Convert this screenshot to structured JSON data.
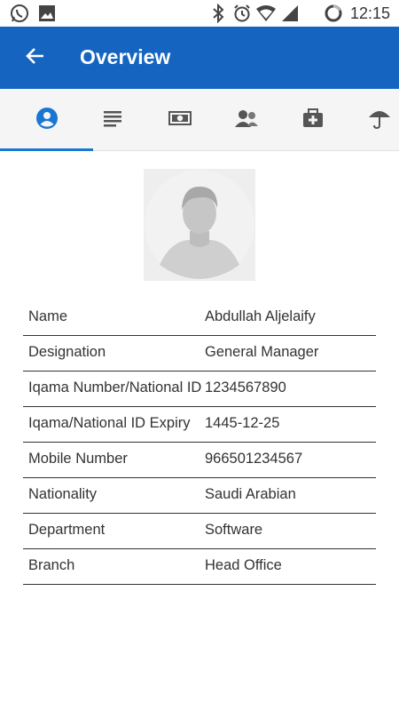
{
  "status_bar": {
    "time": "12:15",
    "icons": [
      "whatsapp-icon",
      "image-icon",
      "bluetooth-icon",
      "alarm-icon",
      "wifi-icon",
      "signal-icon",
      "battery-icon"
    ]
  },
  "app_bar": {
    "back_icon": "arrow-back-icon",
    "title": "Overview",
    "background": "#1565c0"
  },
  "tabs": [
    {
      "icon": "person-icon",
      "active": true
    },
    {
      "icon": "list-icon",
      "active": false
    },
    {
      "icon": "money-icon",
      "active": false
    },
    {
      "icon": "people-icon",
      "active": false
    },
    {
      "icon": "medical-bag-icon",
      "active": false
    },
    {
      "icon": "umbrella-icon",
      "active": false
    }
  ],
  "accent_color": "#1976d2",
  "avatar": {
    "icon": "avatar-placeholder-icon"
  },
  "details": [
    {
      "label": "Name",
      "value": "Abdullah Aljelaify"
    },
    {
      "label": "Designation",
      "value": "General Manager"
    },
    {
      "label": "Iqama Number/National ID",
      "value": "1234567890"
    },
    {
      "label": "Iqama/National ID Expiry",
      "value": "1445-12-25"
    },
    {
      "label": "Mobile Number",
      "value": "966501234567"
    },
    {
      "label": "Nationality",
      "value": "Saudi Arabian"
    },
    {
      "label": "Department",
      "value": "Software"
    },
    {
      "label": "Branch",
      "value": "Head Office"
    }
  ]
}
